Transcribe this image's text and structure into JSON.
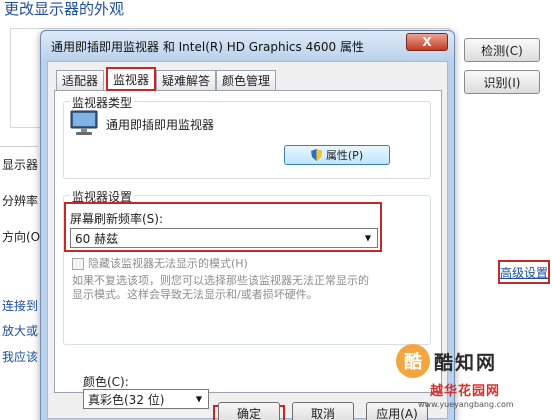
{
  "background": {
    "title": "更改显示器的外观",
    "detect_button": "检测(C)",
    "identify_button": "识别(I)",
    "labels": [
      "显示器",
      "分辨率",
      "方向(O"
    ],
    "links": [
      "连接到",
      "放大或",
      "我应该"
    ],
    "advanced_link": "高级设置"
  },
  "dialog": {
    "title": "通用即插即用监视器 和 Intel(R) HD Graphics 4600 属性",
    "close_glyph": "X",
    "tabs": [
      {
        "label": "适配器"
      },
      {
        "label": "监视器"
      },
      {
        "label": "疑难解答"
      },
      {
        "label": "颜色管理"
      }
    ],
    "monitor_type": {
      "group_title": "监视器类型",
      "monitor_name": "通用即插即用监视器",
      "properties_button": "属性(P)"
    },
    "monitor_settings": {
      "group_title": "监视器设置",
      "refresh_label": "屏幕刷新频率(S):",
      "refresh_value": "60 赫兹",
      "hide_modes_label": "隐藏该监视器无法显示的模式(H)",
      "warning_line1": "如果不复选该项，则您可以选择那些该监视器无法正常显示的",
      "warning_line2": "显示模式。这样会导致无法显示和/或者损坏硬件。"
    },
    "colors": {
      "label": "颜色(C):",
      "value": "真彩色(32 位)"
    },
    "buttons": {
      "ok": "确定",
      "cancel": "取消",
      "apply": "应用(A)"
    }
  },
  "watermark": {
    "logo_glyph": "酷",
    "name": "酷知网",
    "site": "越华花园网",
    "url": "www.yueyangbang.com"
  },
  "colors": {
    "highlight": "#c62828",
    "link": "#1a4fa0"
  }
}
